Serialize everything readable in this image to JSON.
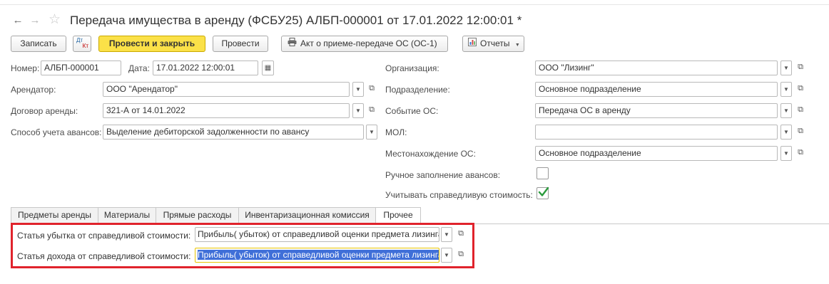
{
  "window": {
    "title": "Передача имущества в аренду (ФСБУ25) АЛБП-000001 от 17.01.2022 12:00:01 *"
  },
  "toolbar": {
    "save_label": "Записать",
    "dtkt_top": "Дт",
    "dtkt_bottom": "Кт",
    "post_close_label": "Провести и закрыть",
    "post_label": "Провести",
    "act_label": "Акт о приеме-передаче ОС (ОС-1)",
    "reports_label": "Отчеты"
  },
  "header": {
    "number_label": "Номер:",
    "number_value": "АЛБП-000001",
    "date_label": "Дата:",
    "date_value": "17.01.2022 12:00:01"
  },
  "left": {
    "lessee_label": "Арендатор:",
    "lessee_value": "ООО \"Арендатор\"",
    "contract_label": "Договор аренды:",
    "contract_value": "321-А от 14.01.2022",
    "advance_label": "Способ учета авансов:",
    "advance_value": "Выделение дебиторской задолженности по авансу"
  },
  "right": {
    "org_label": "Организация:",
    "org_value": "ООО \"Лизинг\"",
    "division_label": "Подразделение:",
    "division_value": "Основное подразделение",
    "event_label": "Событие ОС:",
    "event_value": "Передача ОС в аренду",
    "mol_label": "МОЛ:",
    "mol_value": "",
    "location_label": "Местонахождение ОС:",
    "location_value": "Основное подразделение",
    "manual_label": "Ручное заполнение авансов:",
    "manual_checked": false,
    "fair_label": "Учитывать справедливую стоимость:",
    "fair_checked": true
  },
  "tabs": [
    {
      "label": "Предметы аренды"
    },
    {
      "label": "Материалы"
    },
    {
      "label": "Прямые расходы"
    },
    {
      "label": "Инвентаризационная комиссия"
    },
    {
      "label": "Прочее"
    }
  ],
  "other": {
    "loss_label": "Статья убытка от справедливой стоимости:",
    "loss_value": "Прибыль( убыток) от справедливой оценки  предмета лизинга",
    "income_label": "Статья дохода от справедливой стоимости:",
    "income_value": "Прибыль( убыток) от справедливой оценки  предмета лизинга"
  },
  "colors": {
    "accent_yellow": "#fbe148",
    "highlight_red": "#e0232c",
    "selection_blue": "#3f6fd8",
    "check_green": "#2a9a3c"
  }
}
